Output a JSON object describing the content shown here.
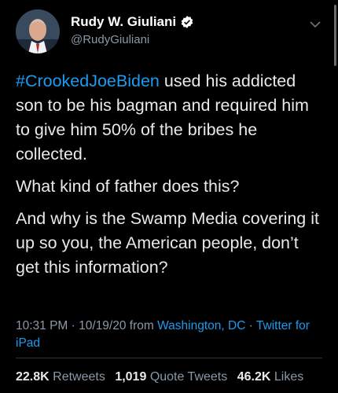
{
  "profile": {
    "display_name": "Rudy W. Giuliani",
    "handle": "@RudyGiuliani"
  },
  "tweet": {
    "hashtag": "#CrookedJoeBiden",
    "line1_rest": " used his addicted son to be his bagman and required him to give him 50% of the bribes he collected.",
    "para2": "What kind of father does this?",
    "para3": "And why is the Swamp Media covering it up so you, the American people, don’t get this information?"
  },
  "meta": {
    "time": "10:31 PM",
    "sep1": " · ",
    "date": "10/19/20",
    "from_word": " from ",
    "location": "Washington, DC",
    "sep2": " · ",
    "source": "Twitter for iPad"
  },
  "stats": {
    "retweets_count": "22.8K",
    "retweets_label": "Retweets",
    "quote_count": "1,019",
    "quote_label": "Quote Tweets",
    "likes_count": "46.2K",
    "likes_label": "Likes"
  },
  "colors": {
    "background": "#000000",
    "link_blue": "#1d9bf0",
    "secondary_text": "#8b98a5"
  },
  "icons": [
    "verified-badge-icon",
    "chevron-down-icon"
  ]
}
